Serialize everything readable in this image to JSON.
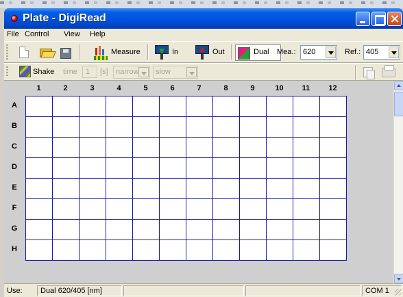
{
  "window": {
    "title": "Plate - DigiRead"
  },
  "menu": [
    "File",
    "Control",
    "View",
    "Help"
  ],
  "toolbar": {
    "measure_label": "Measure",
    "in_label": "In",
    "out_label": "Out",
    "dual_label": "Dual",
    "mea_label": "Mea.:",
    "mea_value": "620",
    "ref_label": "Ref.:",
    "ref_value": "405"
  },
  "toolbar2": {
    "shake_label": "Shake",
    "time_label": "time",
    "time_value": "1",
    "unit_label": "[s]",
    "mode_value": "narrow",
    "speed_value": "slow"
  },
  "plate": {
    "columns": [
      "1",
      "2",
      "3",
      "4",
      "5",
      "6",
      "7",
      "8",
      "9",
      "10",
      "11",
      "12"
    ],
    "rows": [
      "A",
      "B",
      "C",
      "D",
      "E",
      "F",
      "G",
      "H"
    ]
  },
  "statusbar": {
    "use_label": "Use:",
    "mode_text": "Dual 620/405 [nm]",
    "port_text": "COM 1"
  },
  "colors": {
    "grid_line": "#1a1aa6",
    "titlebar": "#0054e3",
    "client_bg": "#cfcfcf"
  },
  "icons": [
    "new-file-icon",
    "open-folder-icon",
    "save-disk-icon",
    "measure-icon",
    "plate-in-icon",
    "plate-out-icon",
    "dual-wavelength-icon",
    "shake-icon",
    "copy-icon",
    "print-icon"
  ]
}
